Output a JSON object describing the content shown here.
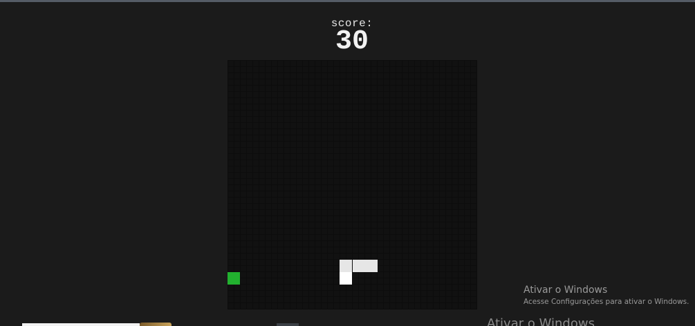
{
  "game": {
    "score_label": "score:",
    "score_value": "30",
    "grid_cells": 20,
    "snake": {
      "color": "#e6e6e6",
      "segments": [
        {
          "col": 9,
          "row": 17
        },
        {
          "col": 9,
          "row": 16
        },
        {
          "col": 10,
          "row": 16
        },
        {
          "col": 11,
          "row": 16
        }
      ]
    },
    "food": {
      "color": "#22b12f",
      "col": 0,
      "row": 17
    },
    "board_color": "#111111"
  },
  "watermark": {
    "title": "Ativar o Windows",
    "subtitle": "Acesse Configurações para ativar o Windows.",
    "ghost_title": "Ativar o Windows"
  }
}
